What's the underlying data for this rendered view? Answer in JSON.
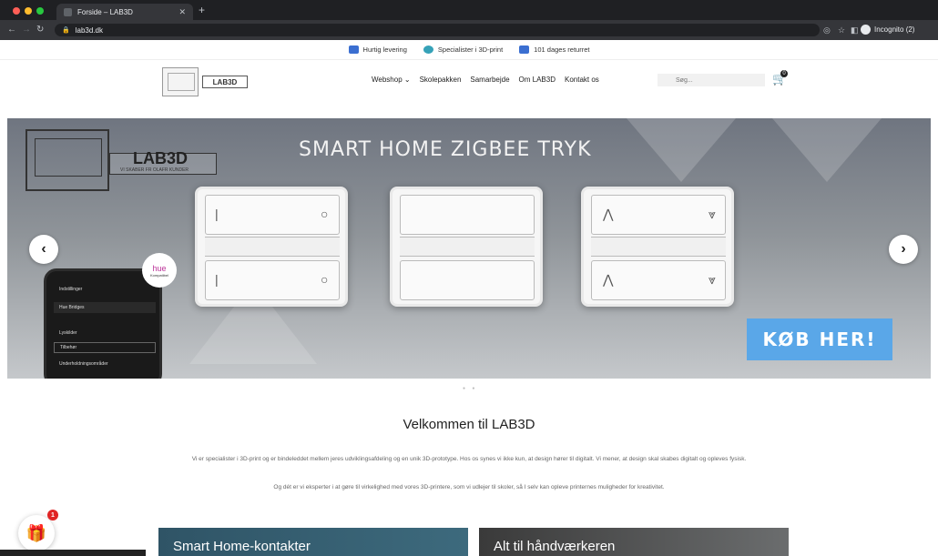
{
  "browser": {
    "tab_title": "Forside – LAB3D",
    "url": "lab3d.dk",
    "profile": "Incognito (2)"
  },
  "announcement": [
    {
      "label": "Hurtig levering",
      "icon": "truck-icon",
      "color": "#3b6fd1"
    },
    {
      "label": "Specialister i 3D-print",
      "icon": "badge-icon",
      "color": "#36a2b8"
    },
    {
      "label": "101 dages returret",
      "icon": "calendar-icon",
      "color": "#3b6fd1"
    }
  ],
  "header": {
    "logo": "LAB3D",
    "nav": [
      "Webshop ⌄",
      "Skolepakken",
      "Samarbejde",
      "Om LAB3D",
      "Kontakt os"
    ],
    "search_placeholder": "Søg...",
    "cart_count": "0"
  },
  "hero": {
    "title": "SMART HOME ZIGBEE TRYK",
    "logo": "LAB3D",
    "logo_sub": "VI SKABER FR OLAFR KUNDER",
    "hue_label": "hue",
    "hue_sub": "Kompatibel",
    "cta": "KØB HER!",
    "phone_rows": [
      "Indstillinger",
      "Hue Bridges",
      "Lyskilder",
      "Tilbehør",
      "Underholdningsområder"
    ]
  },
  "welcome": {
    "title": "Velkommen til LAB3D",
    "p1": "Vi er specialister i 3D-print og er bindeleddet mellem jeres udviklingsafdeling og en unik 3D-prototype. Hos os synes vi ikke kun, at design hører til digitalt. Vi mener, at design skal skabes digitalt og opleves fysisk.",
    "p2": "Og dét er vi eksperter i at gøre til virkelighed med vores 3D-printere, som vi udlejer til skoler, så I selv kan opleve printernes muligheder for kreativitet."
  },
  "gift_count": "1",
  "cards": [
    "Smart Home-kontakter",
    "Alt til håndværkeren"
  ]
}
